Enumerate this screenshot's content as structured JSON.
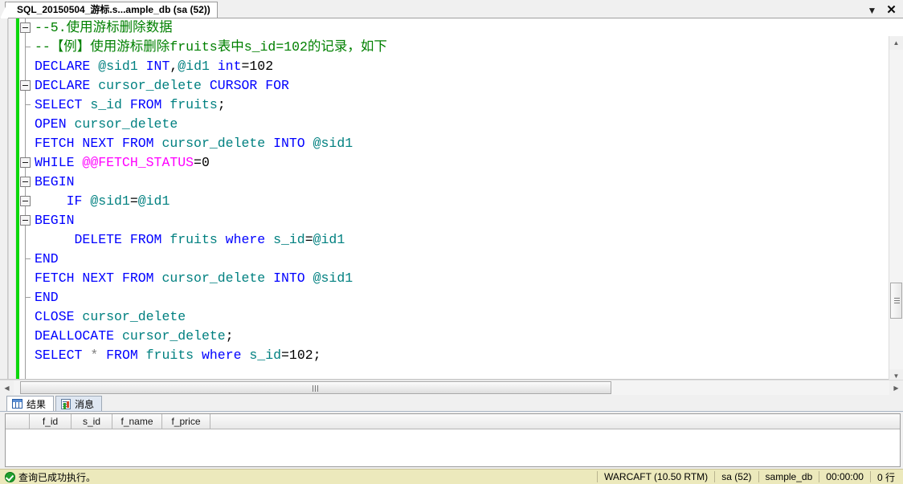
{
  "window": {
    "tab_title": "SQL_20150504_游标.s...ample_db (sa (52))",
    "dropdown_icon": "chevron-down-icon",
    "close_icon": "close-icon"
  },
  "editor": {
    "lines": [
      [
        {
          "t": "--5.使用游标删除数据",
          "c": "cmt"
        }
      ],
      [
        {
          "t": "--【例】使用游标删除fruits表中s_id=102的记录，如下",
          "c": "cmt"
        }
      ],
      [
        {
          "t": "DECLARE",
          "c": "kw"
        },
        {
          "t": " ",
          "c": "plain"
        },
        {
          "t": "@sid1",
          "c": "ident"
        },
        {
          "t": " ",
          "c": "plain"
        },
        {
          "t": "INT",
          "c": "kw"
        },
        {
          "t": ",",
          "c": "plain"
        },
        {
          "t": "@id1",
          "c": "ident"
        },
        {
          "t": " ",
          "c": "plain"
        },
        {
          "t": "int",
          "c": "kw"
        },
        {
          "t": "=",
          "c": "plain"
        },
        {
          "t": "102",
          "c": "num"
        }
      ],
      [
        {
          "t": "DECLARE",
          "c": "kw"
        },
        {
          "t": " ",
          "c": "plain"
        },
        {
          "t": "cursor_delete",
          "c": "ident"
        },
        {
          "t": " ",
          "c": "plain"
        },
        {
          "t": "CURSOR",
          "c": "kw"
        },
        {
          "t": " ",
          "c": "plain"
        },
        {
          "t": "FOR",
          "c": "kw"
        }
      ],
      [
        {
          "t": "SELECT",
          "c": "kw"
        },
        {
          "t": " ",
          "c": "plain"
        },
        {
          "t": "s_id",
          "c": "ident"
        },
        {
          "t": " ",
          "c": "plain"
        },
        {
          "t": "FROM",
          "c": "kw"
        },
        {
          "t": " ",
          "c": "plain"
        },
        {
          "t": "fruits",
          "c": "ident"
        },
        {
          "t": ";",
          "c": "plain"
        }
      ],
      [
        {
          "t": "OPEN",
          "c": "kw"
        },
        {
          "t": " ",
          "c": "plain"
        },
        {
          "t": "cursor_delete",
          "c": "ident"
        }
      ],
      [
        {
          "t": "FETCH",
          "c": "kw"
        },
        {
          "t": " ",
          "c": "plain"
        },
        {
          "t": "NEXT",
          "c": "kw"
        },
        {
          "t": " ",
          "c": "plain"
        },
        {
          "t": "FROM",
          "c": "kw"
        },
        {
          "t": " ",
          "c": "plain"
        },
        {
          "t": "cursor_delete",
          "c": "ident"
        },
        {
          "t": " ",
          "c": "plain"
        },
        {
          "t": "INTO",
          "c": "kw"
        },
        {
          "t": " ",
          "c": "plain"
        },
        {
          "t": "@sid1",
          "c": "ident"
        }
      ],
      [
        {
          "t": "WHILE",
          "c": "kw"
        },
        {
          "t": " ",
          "c": "plain"
        },
        {
          "t": "@@FETCH_STATUS",
          "c": "sysv"
        },
        {
          "t": "=",
          "c": "plain"
        },
        {
          "t": "0",
          "c": "num"
        }
      ],
      [
        {
          "t": "BEGIN",
          "c": "kw"
        }
      ],
      [
        {
          "t": "    IF",
          "c": "kw"
        },
        {
          "t": " ",
          "c": "plain"
        },
        {
          "t": "@sid1",
          "c": "ident"
        },
        {
          "t": "=",
          "c": "plain"
        },
        {
          "t": "@id1",
          "c": "ident"
        }
      ],
      [
        {
          "t": "BEGIN",
          "c": "kw"
        }
      ],
      [
        {
          "t": "     DELETE",
          "c": "kw"
        },
        {
          "t": " ",
          "c": "plain"
        },
        {
          "t": "FROM",
          "c": "kw"
        },
        {
          "t": " ",
          "c": "plain"
        },
        {
          "t": "fruits",
          "c": "ident"
        },
        {
          "t": " ",
          "c": "plain"
        },
        {
          "t": "where",
          "c": "kw"
        },
        {
          "t": " ",
          "c": "plain"
        },
        {
          "t": "s_id",
          "c": "ident"
        },
        {
          "t": "=",
          "c": "plain"
        },
        {
          "t": "@id1",
          "c": "ident"
        }
      ],
      [
        {
          "t": "END",
          "c": "kw"
        }
      ],
      [
        {
          "t": "FETCH",
          "c": "kw"
        },
        {
          "t": " ",
          "c": "plain"
        },
        {
          "t": "NEXT",
          "c": "kw"
        },
        {
          "t": " ",
          "c": "plain"
        },
        {
          "t": "FROM",
          "c": "kw"
        },
        {
          "t": " ",
          "c": "plain"
        },
        {
          "t": "cursor_delete",
          "c": "ident"
        },
        {
          "t": " ",
          "c": "plain"
        },
        {
          "t": "INTO",
          "c": "kw"
        },
        {
          "t": " ",
          "c": "plain"
        },
        {
          "t": "@sid1",
          "c": "ident"
        }
      ],
      [
        {
          "t": "END",
          "c": "kw"
        }
      ],
      [
        {
          "t": "CLOSE",
          "c": "kw"
        },
        {
          "t": " ",
          "c": "plain"
        },
        {
          "t": "cursor_delete",
          "c": "ident"
        }
      ],
      [
        {
          "t": "DEALLOCATE",
          "c": "kw"
        },
        {
          "t": " ",
          "c": "plain"
        },
        {
          "t": "cursor_delete",
          "c": "ident"
        },
        {
          "t": ";",
          "c": "plain"
        }
      ],
      [
        {
          "t": "SELECT",
          "c": "kw"
        },
        {
          "t": " ",
          "c": "plain"
        },
        {
          "t": "*",
          "c": "op"
        },
        {
          "t": " ",
          "c": "plain"
        },
        {
          "t": "FROM",
          "c": "kw"
        },
        {
          "t": " ",
          "c": "plain"
        },
        {
          "t": "fruits",
          "c": "ident"
        },
        {
          "t": " ",
          "c": "plain"
        },
        {
          "t": "where",
          "c": "kw"
        },
        {
          "t": " ",
          "c": "plain"
        },
        {
          "t": "s_id",
          "c": "ident"
        },
        {
          "t": "=",
          "c": "plain"
        },
        {
          "t": "102",
          "c": "num"
        },
        {
          "t": ";",
          "c": "plain"
        }
      ]
    ],
    "colors": {
      "keyword": "#0000ff",
      "identifier": "#008080",
      "comment": "#008000",
      "system_variable": "#ff00ff",
      "operator": "#808080",
      "change_bar": "#0ad80a"
    }
  },
  "results": {
    "tabs": [
      {
        "label": "结果",
        "icon": "grid-icon",
        "active": true
      },
      {
        "label": "消息",
        "icon": "message-icon",
        "active": false
      }
    ],
    "grid": {
      "columns": [
        "f_id",
        "s_id",
        "f_name",
        "f_price"
      ],
      "rows": []
    }
  },
  "statusbar": {
    "message": "查询已成功执行。",
    "status_icon": "success-check-icon",
    "server": "WARCAFT (10.50 RTM)",
    "login": "sa (52)",
    "database": "sample_db",
    "elapsed": "00:00:00",
    "rowcount": "0 行"
  }
}
